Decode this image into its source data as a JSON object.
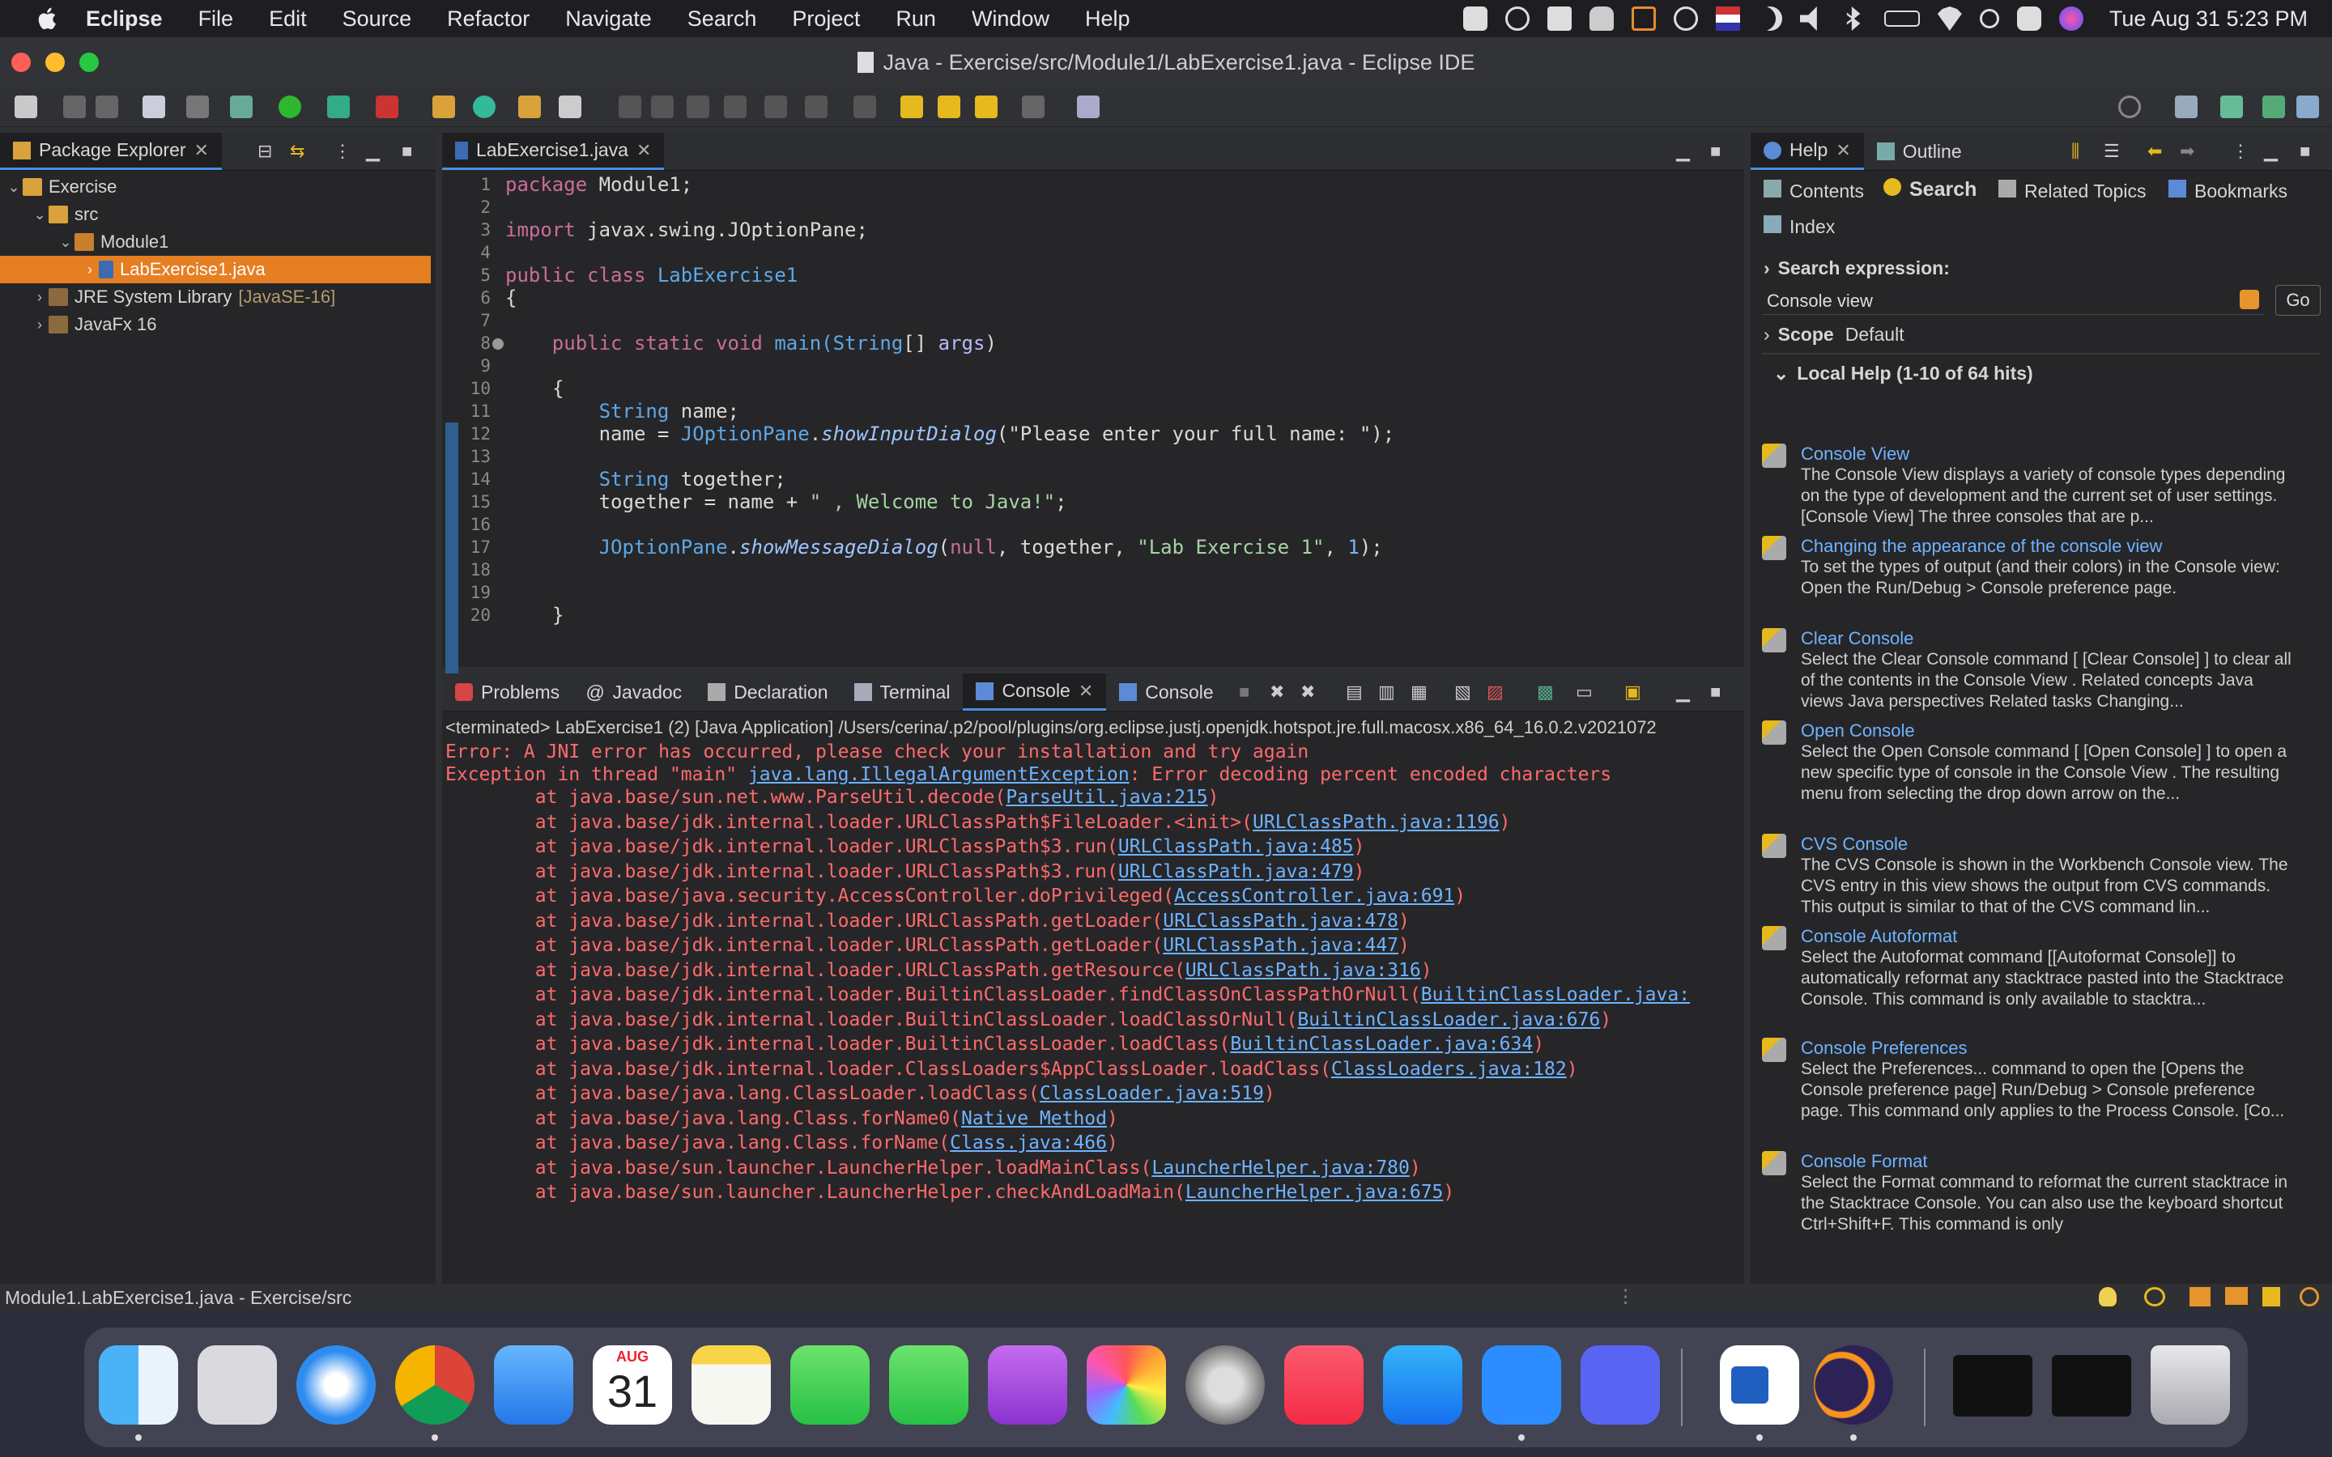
{
  "menubar": {
    "app": "Eclipse",
    "items": [
      "File",
      "Edit",
      "Source",
      "Refactor",
      "Navigate",
      "Search",
      "Project",
      "Run",
      "Window",
      "Help"
    ],
    "datetime": "Tue Aug 31  5:23 PM"
  },
  "window": {
    "title": "Java - Exercise/src/Module1/LabExercise1.java - Eclipse IDE"
  },
  "package_explorer": {
    "tab": "Package Explorer",
    "tree": {
      "project": "Exercise",
      "src": "src",
      "package": "Module1",
      "file": "LabExercise1.java",
      "jre": "JRE System Library",
      "jre_version": "[JavaSE-16]",
      "javafx": "JavaFx 16"
    }
  },
  "editor": {
    "tab": "LabExercise1.java",
    "line_numbers": [
      "1",
      "2",
      "3",
      "4",
      "5",
      "6",
      "7",
      "8",
      "9",
      "10",
      "11",
      "12",
      "13",
      "14",
      "15",
      "16",
      "17",
      "18",
      "19",
      "20"
    ],
    "lines": {
      "l1_kw": "package",
      "l1_rest": " Module1;",
      "l3_kw": "import",
      "l3_rest": " javax.swing.JOptionPane;",
      "l5_kw": "public class",
      "l5_cls": "LabExercise1",
      "l6": "{",
      "l8_kw": "public static void",
      "l8_m": "main(",
      "l8_t": "String",
      "l8_rest": "[] ",
      "l8_a": "args",
      "l8_end": ")",
      "l10": "{",
      "l11_t": "String",
      "l11_rest": " name;",
      "l12_a": "name = ",
      "l12_c": "JOptionPane",
      "l12_dot": ".",
      "l12_m": "showInputDialog",
      "l12_s": "(\"Please enter your full name: \");",
      "l14_t": "String",
      "l14_rest": " together;",
      "l15_a": "together = name + ",
      "l15_s": "\" , Welcome to Java!\"",
      "l15_end": ";",
      "l17_c": "JOptionPane",
      "l17_dot": ".",
      "l17_m": "showMessageDialog",
      "l17_p": "(",
      "l17_null": "null",
      "l17_b": ", together, ",
      "l17_s": "\"Lab Exercise 1\"",
      "l17_c2": ", ",
      "l17_n": "1",
      "l17_end": ");",
      "l20": "}"
    }
  },
  "bottom_tabs": [
    "Problems",
    "Javadoc",
    "Declaration",
    "Terminal",
    "Console",
    "Console"
  ],
  "console": {
    "header": "<terminated> LabExercise1 (2) [Java Application] /Users/cerina/.p2/pool/plugins/org.eclipse.justj.openjdk.hotspot.jre.full.macosx.x86_64_16.0.2.v2021072",
    "error_line": "Error: A JNI error has occurred, please check your installation and try again",
    "exception_prefix": "Exception in thread \"main\" ",
    "exception_link": "java.lang.IllegalArgumentException",
    "exception_suffix": ": Error decoding percent encoded characters",
    "trace": [
      {
        "at": "\tat java.base/sun.net.www.ParseUtil.decode(",
        "link": "ParseUtil.java:215",
        "end": ")"
      },
      {
        "at": "\tat java.base/jdk.internal.loader.URLClassPath$FileLoader.<init>(",
        "link": "URLClassPath.java:1196",
        "end": ")"
      },
      {
        "at": "\tat java.base/jdk.internal.loader.URLClassPath$3.run(",
        "link": "URLClassPath.java:485",
        "end": ")"
      },
      {
        "at": "\tat java.base/jdk.internal.loader.URLClassPath$3.run(",
        "link": "URLClassPath.java:479",
        "end": ")"
      },
      {
        "at": "\tat java.base/java.security.AccessController.doPrivileged(",
        "link": "AccessController.java:691",
        "end": ")"
      },
      {
        "at": "\tat java.base/jdk.internal.loader.URLClassPath.getLoader(",
        "link": "URLClassPath.java:478",
        "end": ")"
      },
      {
        "at": "\tat java.base/jdk.internal.loader.URLClassPath.getLoader(",
        "link": "URLClassPath.java:447",
        "end": ")"
      },
      {
        "at": "\tat java.base/jdk.internal.loader.URLClassPath.getResource(",
        "link": "URLClassPath.java:316",
        "end": ")"
      },
      {
        "at": "\tat java.base/jdk.internal.loader.BuiltinClassLoader.findClassOnClassPathOrNull(",
        "link": "BuiltinClassLoader.java:",
        "end": ""
      },
      {
        "at": "\tat java.base/jdk.internal.loader.BuiltinClassLoader.loadClassOrNull(",
        "link": "BuiltinClassLoader.java:676",
        "end": ")"
      },
      {
        "at": "\tat java.base/jdk.internal.loader.BuiltinClassLoader.loadClass(",
        "link": "BuiltinClassLoader.java:634",
        "end": ")"
      },
      {
        "at": "\tat java.base/jdk.internal.loader.ClassLoaders$AppClassLoader.loadClass(",
        "link": "ClassLoaders.java:182",
        "end": ")"
      },
      {
        "at": "\tat java.base/java.lang.ClassLoader.loadClass(",
        "link": "ClassLoader.java:519",
        "end": ")"
      },
      {
        "at": "\tat java.base/java.lang.Class.forName0(",
        "link": "Native Method",
        "end": ")"
      },
      {
        "at": "\tat java.base/java.lang.Class.forName(",
        "link": "Class.java:466",
        "end": ")"
      },
      {
        "at": "\tat java.base/sun.launcher.LauncherHelper.loadMainClass(",
        "link": "LauncherHelper.java:780",
        "end": ")"
      },
      {
        "at": "\tat java.base/sun.launcher.LauncherHelper.checkAndLoadMain(",
        "link": "LauncherHelper.java:675",
        "end": ")"
      }
    ]
  },
  "help": {
    "tab_help": "Help",
    "tab_outline": "Outline",
    "nav": {
      "contents": "Contents",
      "search": "Search",
      "related": "Related Topics",
      "bookmarks": "Bookmarks",
      "index": "Index"
    },
    "search_label": "Search expression:",
    "search_value": "Console view",
    "go": "Go",
    "scope_label": "Scope",
    "scope_value": "Default",
    "local_help": "Local Help (1-10 of 64 hits)",
    "hits": [
      {
        "title": "Console View",
        "desc": "The Console View displays a variety of console types depending on the type of development and the current set of user settings. [Console View] The three consoles that are p..."
      },
      {
        "title": "Changing the appearance of the console view",
        "desc": "To set the types of output (and their colors) in the Console view: Open the Run/Debug > Console preference page."
      },
      {
        "title": "Clear Console",
        "desc": "Select the Clear Console command [ [Clear Console] ] to clear all of the contents in the Console View . Related concepts Java views Java perspectives Related tasks Changing..."
      },
      {
        "title": "Open Console",
        "desc": "Select the Open Console command [ [Open Console] ] to open a new specific type of console in the Console View . The resulting menu from selecting the drop down arrow on the..."
      },
      {
        "title": "CVS Console",
        "desc": "The CVS Console is shown in the Workbench Console view. The CVS entry in this view shows the output from CVS commands. This output is similar to that of the CVS command lin..."
      },
      {
        "title": "Console Autoformat",
        "desc": "Select the Autoformat command [[Autoformat Console]] to automatically reformat any stacktrace pasted into the Stacktrace Console. This command is only available to stacktra..."
      },
      {
        "title": "Console Preferences",
        "desc": "Select the Preferences... command to open the [Opens the Console preference page] Run/Debug > Console preference page. This command only applies to the Process Console. [Co..."
      },
      {
        "title": "Console Format",
        "desc": "Select the Format command to reformat the current stacktrace in the Stacktrace Console. You can also use the keyboard shortcut Ctrl+Shift+F. This command is only"
      }
    ]
  },
  "status": {
    "text": "Module1.LabExercise1.java - Exercise/src"
  },
  "dock": {
    "calendar_month": "AUG",
    "calendar_day": "31"
  },
  "colors": {
    "accent": "#e67e22",
    "link": "#6fb3ff",
    "error": "#ff6b6b"
  }
}
